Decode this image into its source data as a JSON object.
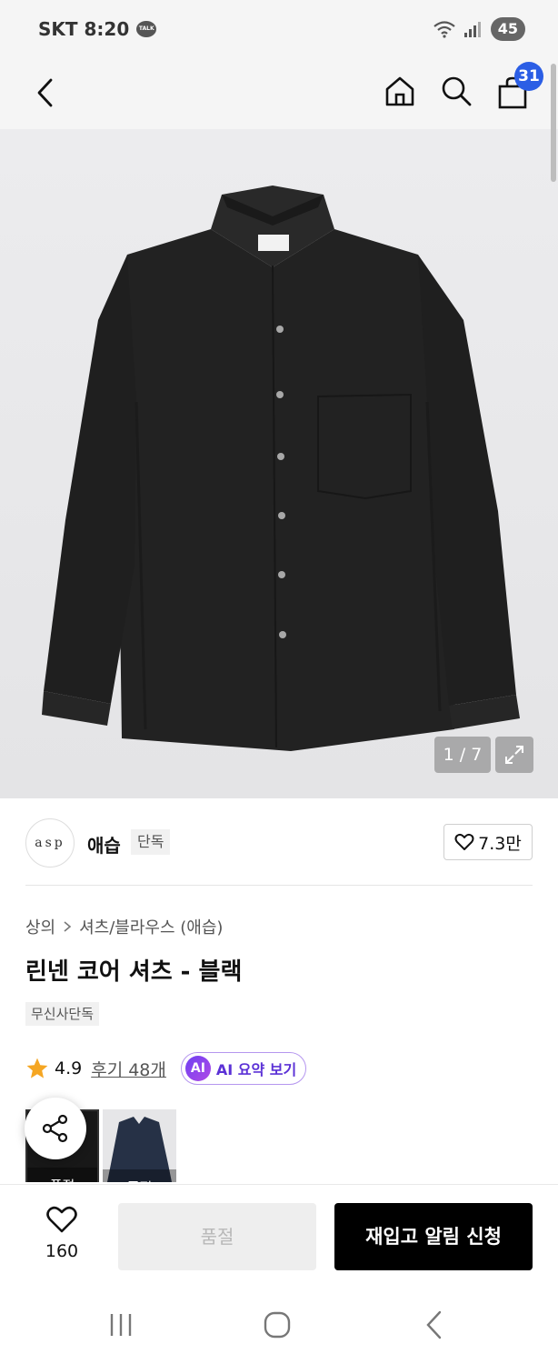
{
  "status_bar": {
    "carrier_time": "SKT 8:20",
    "talk_badge": "TALK",
    "battery": "45"
  },
  "header": {
    "cart_count": "31"
  },
  "gallery": {
    "counter": "1 / 7",
    "garment_tag": "a s p"
  },
  "brand": {
    "logo_text": "asp",
    "name": "애습",
    "badge": "단독",
    "likes": "7.3만"
  },
  "product": {
    "breadcrumb": [
      "상의",
      "셔츠/블라우스 (애습)"
    ],
    "title": "린넨 코어 셔츠 - 블랙",
    "badge": "무신사단독",
    "rating": "4.9",
    "reviews": "후기 48개",
    "ai_icon": "AI",
    "ai_summary": "AI 요약 보기",
    "color_options": [
      {
        "label": "품절",
        "color": "#181818"
      },
      {
        "label": "품절",
        "color": "#2a3448"
      }
    ]
  },
  "actions": {
    "wish_count": "160",
    "soldout_label": "품절",
    "restock_label": "재입고 알림 신청"
  },
  "colors": {
    "accent_blue": "#2b5ee5",
    "ai_purple": "#6f3ff2",
    "star": "#f5a623"
  }
}
